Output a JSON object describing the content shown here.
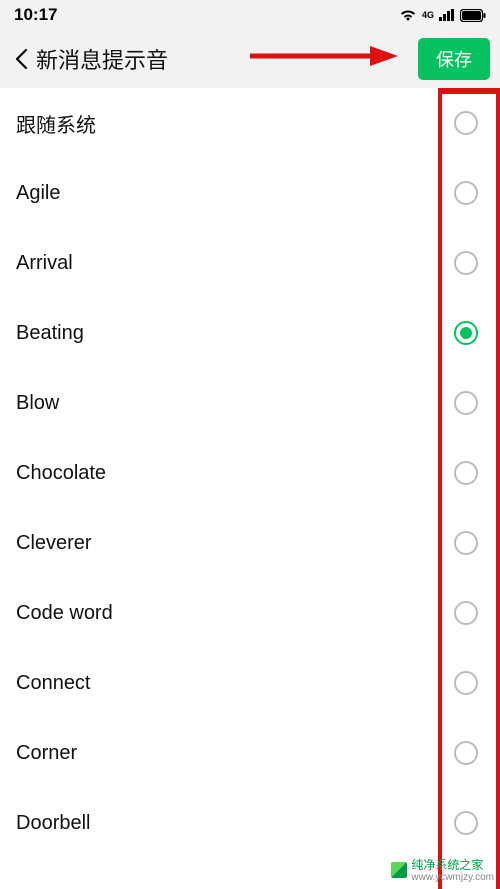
{
  "status": {
    "time": "10:17",
    "icons": [
      "wifi-icon",
      "signal-4g-icon",
      "signal-bars-icon",
      "battery-icon"
    ]
  },
  "header": {
    "title": "新消息提示音",
    "save_label": "保存"
  },
  "annotation": {
    "arrow": true
  },
  "sounds": {
    "selected_index": 3,
    "items": [
      {
        "label": "跟随系统"
      },
      {
        "label": "Agile"
      },
      {
        "label": "Arrival"
      },
      {
        "label": "Beating"
      },
      {
        "label": "Blow"
      },
      {
        "label": "Chocolate"
      },
      {
        "label": "Cleverer"
      },
      {
        "label": "Code word"
      },
      {
        "label": "Connect"
      },
      {
        "label": "Corner"
      },
      {
        "label": "Doorbell"
      }
    ]
  },
  "watermark": {
    "line1": "纯净系统之家",
    "line2": "www.ycwmjzy.com"
  },
  "colors": {
    "accent": "#07c160",
    "annotation": "#d11"
  }
}
